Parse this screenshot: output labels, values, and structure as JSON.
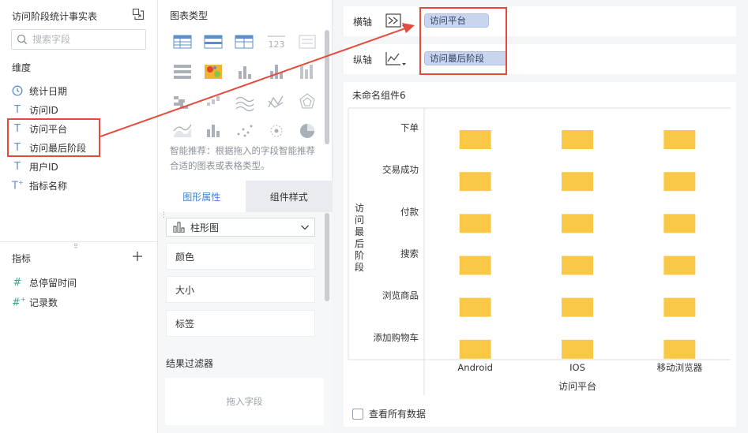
{
  "left_panel": {
    "title": "访问阶段统计事实表",
    "search_placeholder": "搜索字段",
    "dimensions_label": "维度",
    "dimensions": [
      {
        "icon": "clock",
        "label": "统计日期"
      },
      {
        "icon": "T",
        "label": "访问ID"
      },
      {
        "icon": "T",
        "label": "访问平台"
      },
      {
        "icon": "T",
        "label": "访问最后阶段"
      },
      {
        "icon": "T",
        "label": "用户ID"
      },
      {
        "icon": "T+",
        "label": "指标名称"
      }
    ],
    "measures_label": "指标",
    "measures": [
      {
        "icon": "#",
        "label": "总停留时间"
      },
      {
        "icon": "#+",
        "label": "记录数"
      }
    ]
  },
  "middle_panel": {
    "chart_types_title": "图表类型",
    "smart_tip": "智能推荐：根据拖入的字段智能推荐合适的图表或表格类型。",
    "tabs": [
      "图形属性",
      "组件样式"
    ],
    "chart_select": "柱形图",
    "properties": [
      "颜色",
      "大小",
      "标签"
    ],
    "filter_title": "结果过滤器",
    "filter_drop": "拖入字段"
  },
  "axes": {
    "x_label": "横轴",
    "x_field": "访问平台",
    "y_label": "纵轴",
    "y_field": "访问最后阶段"
  },
  "chart_card": {
    "title": "未命名组件6",
    "footer_checkbox": "查看所有数据"
  },
  "colors": {
    "accent": "#3b82d6",
    "bar": "#f9c846",
    "highlight": "#e54b3d",
    "pill": "#c9d5ee"
  },
  "chart_data": {
    "type": "bar",
    "categories": [
      "Android",
      "IOS",
      "移动浏览器"
    ],
    "row_categories": [
      "下单",
      "交易成功",
      "付款",
      "搜索",
      "浏览商品",
      "添加购物车"
    ],
    "xlabel": "访问平台",
    "ylabel": "访问最后阶段"
  }
}
